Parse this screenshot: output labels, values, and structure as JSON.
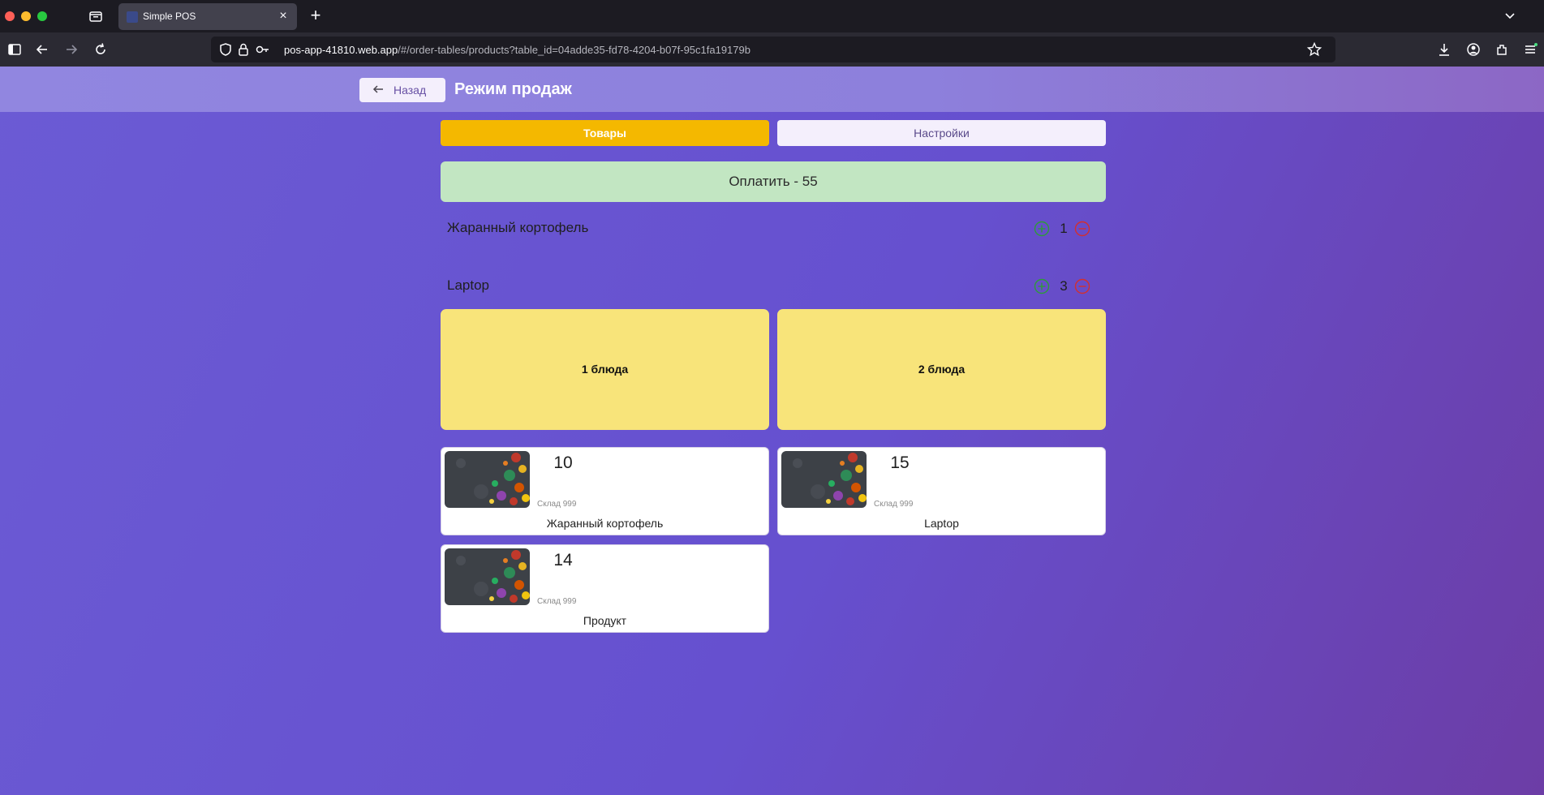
{
  "browser": {
    "tab_title": "Simple POS",
    "url_host": "pos-app-41810.web.app",
    "url_rest": "/#/order-tables/products?table_id=04adde35-fd78-4204-b07f-95c1fa19179b"
  },
  "header": {
    "back_label": "Назад",
    "title": "Режим продаж"
  },
  "tabs": {
    "products": "Товары",
    "settings": "Настройки"
  },
  "pay": {
    "label": "Оплатить - 55"
  },
  "order_items": [
    {
      "name": "Жаранный кортофель",
      "qty": "1"
    },
    {
      "name": "Laptop",
      "qty": "3"
    }
  ],
  "categories": [
    {
      "label": "1 блюда"
    },
    {
      "label": "2 блюда"
    }
  ],
  "products": [
    {
      "price": "10",
      "stock": "Склад 999",
      "name": "Жаранный кортофель"
    },
    {
      "price": "15",
      "stock": "Склад 999",
      "name": "Laptop"
    },
    {
      "price": "14",
      "stock": "Склад 999",
      "name": "Продукт"
    }
  ],
  "colors": {
    "accent": "#f4b800",
    "pay_bg": "#c2e6c2",
    "category_bg": "#f8e47a",
    "plus": "#2e9b3a",
    "minus": "#d32f2f"
  }
}
